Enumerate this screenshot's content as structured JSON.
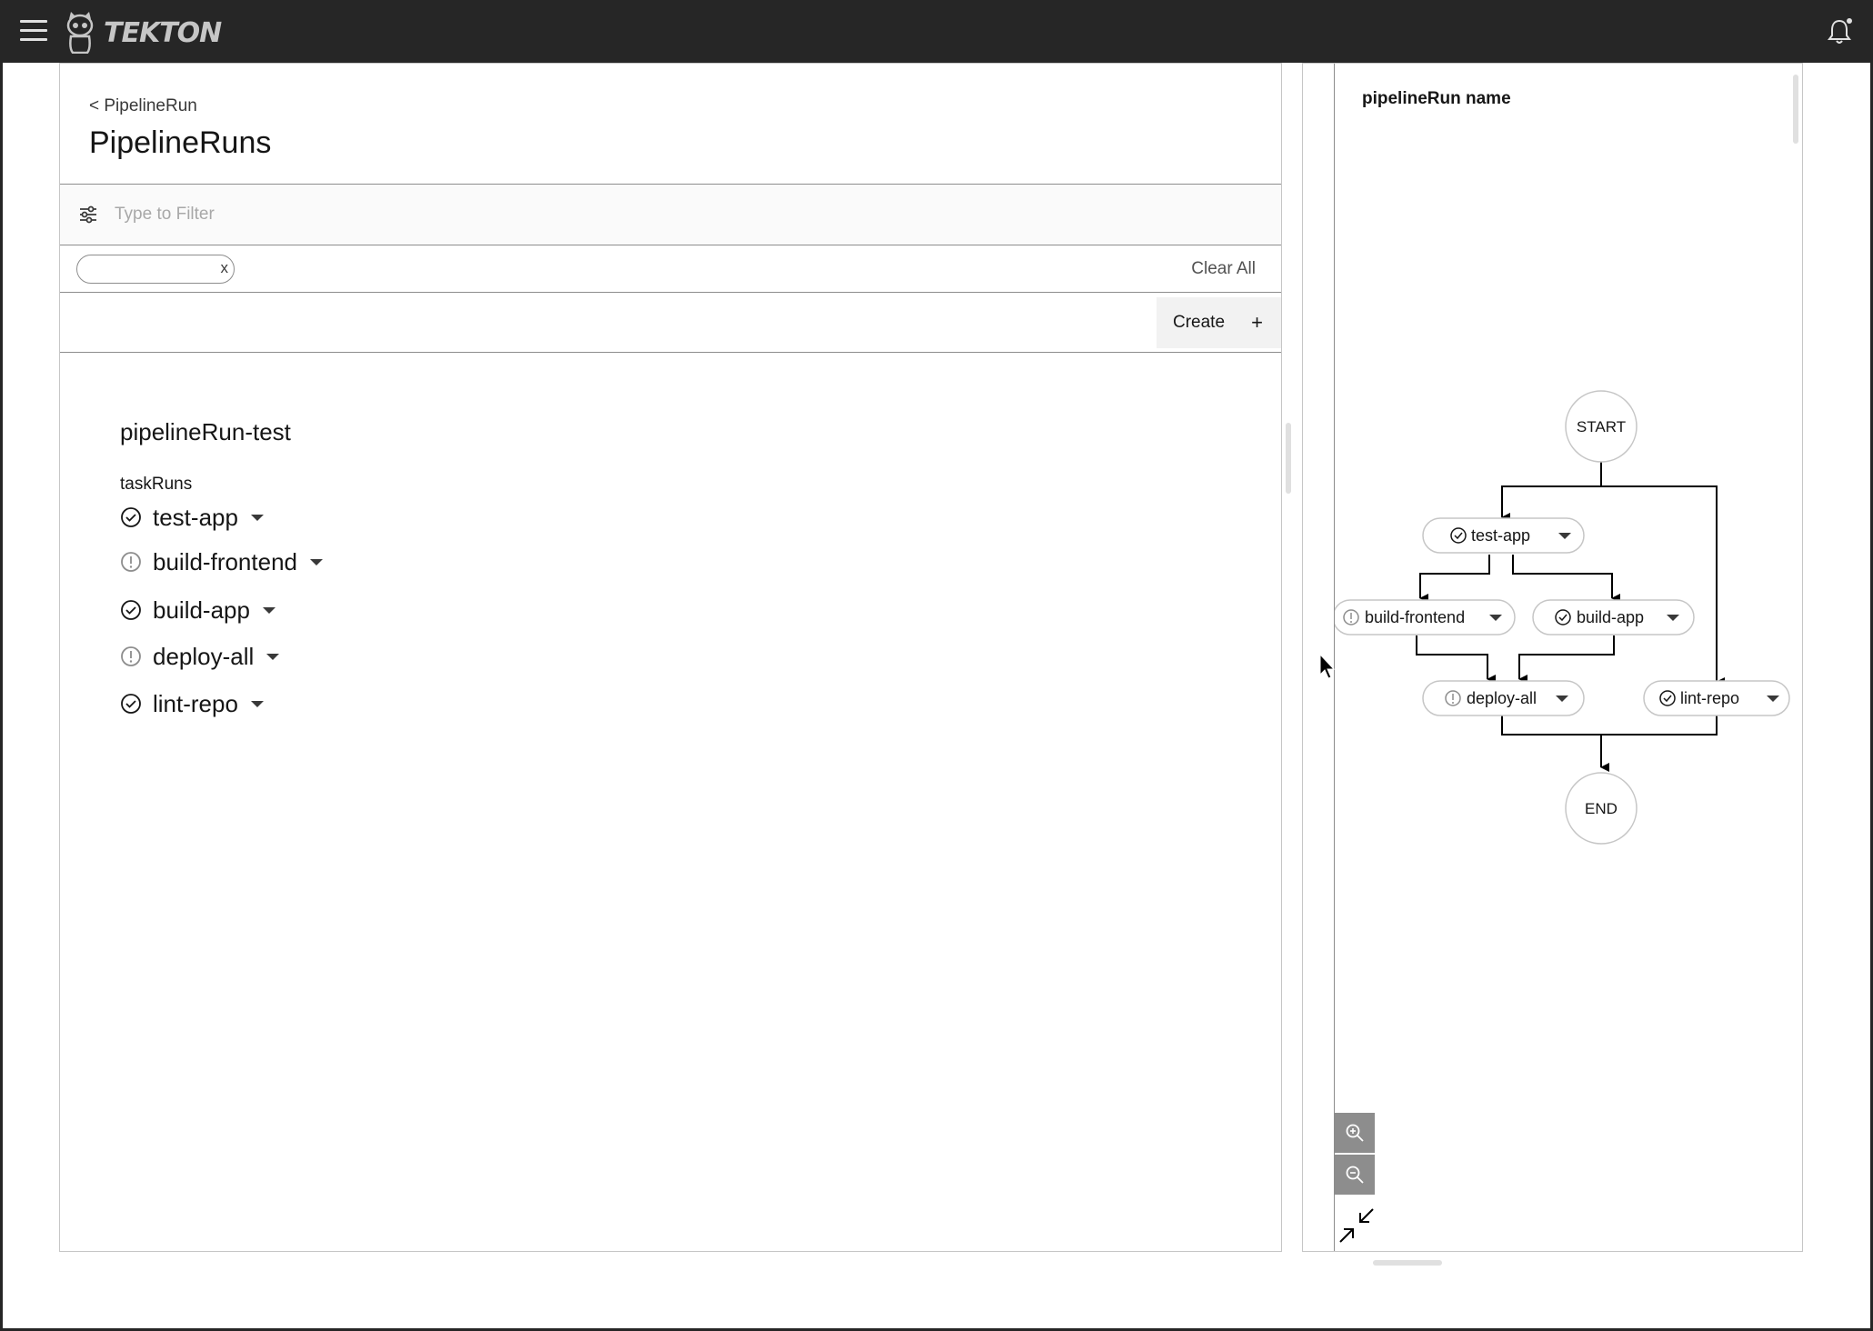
{
  "app": {
    "logo_text": "TEKTON"
  },
  "header": {
    "breadcrumb": "< PipelineRun",
    "title": "PipelineRuns"
  },
  "filter": {
    "placeholder": "Type to Filter",
    "tag_remove": "x",
    "clear_all": "Clear All"
  },
  "toolbar": {
    "create_label": "Create",
    "create_icon": "+"
  },
  "pipeline_run": {
    "name": "pipelineRun-test",
    "taskruns_label": "taskRuns",
    "task_runs": [
      {
        "name": "test-app",
        "status": "success"
      },
      {
        "name": "build-frontend",
        "status": "warning"
      },
      {
        "name": "build-app",
        "status": "success"
      },
      {
        "name": "deploy-all",
        "status": "warning"
      },
      {
        "name": "lint-repo",
        "status": "success"
      }
    ]
  },
  "graph": {
    "title": "pipelineRun name",
    "start_label": "START",
    "end_label": "END",
    "nodes": [
      {
        "name": "test-app",
        "status": "success"
      },
      {
        "name": "build-frontend",
        "status": "warning"
      },
      {
        "name": "build-app",
        "status": "success"
      },
      {
        "name": "deploy-all",
        "status": "warning"
      },
      {
        "name": "lint-repo",
        "status": "success"
      }
    ],
    "controls": [
      "zoom-in-icon",
      "zoom-out-icon",
      "fit-to-screen-icon"
    ]
  },
  "colors": {
    "topbar": "#262626",
    "border": "#8d8d8d",
    "text": "#161616"
  }
}
